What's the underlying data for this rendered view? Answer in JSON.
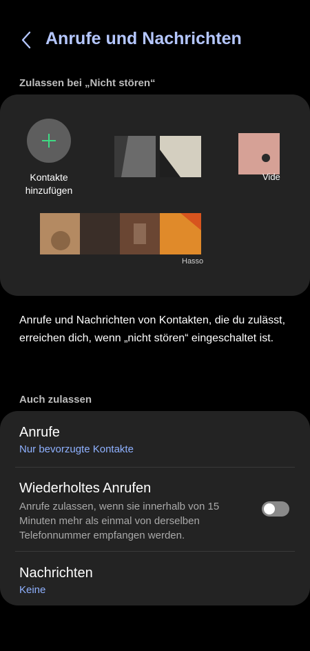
{
  "header": {
    "title": "Anrufe und Nachrichten",
    "back_icon": "chevron-left-icon"
  },
  "allow_section": {
    "label": "Zulassen bei „Nicht stören“",
    "add_contact_label": "Kontakte hinzufügen",
    "contacts": [
      {
        "name": "",
        "color": "#6b6b6b"
      },
      {
        "name": "",
        "color": "#d4cfc0"
      },
      {
        "name": "Vide",
        "color": "#d6a196"
      },
      {
        "name": "",
        "color": "#b48a62"
      },
      {
        "name": "",
        "color": "#3a2e28"
      },
      {
        "name": "",
        "color": "#6a4633"
      },
      {
        "name": "Hasso",
        "color": "#e08a2a"
      }
    ]
  },
  "info_text": "Anrufe und Nachrichten von Kontakten, die du zulässt, erreichen dich, wenn „nicht stören“ eingeschaltet ist.",
  "also_allow": {
    "label": "Auch zulassen",
    "calls": {
      "title": "Anrufe",
      "value": "Nur bevorzugte Kontakte"
    },
    "repeat_calls": {
      "title": "Wiederholtes Anrufen",
      "description": "Anrufe zulassen, wenn sie innerhalb von 15 Minuten mehr als einmal von derselben Telefonnummer empfangen werden.",
      "enabled": false
    },
    "messages": {
      "title": "Nachrichten",
      "value": "Keine"
    }
  },
  "colors": {
    "accent": "#b5c7ff",
    "link": "#8fb1ff",
    "card": "#232323",
    "add_plus": "#3ddc84"
  }
}
